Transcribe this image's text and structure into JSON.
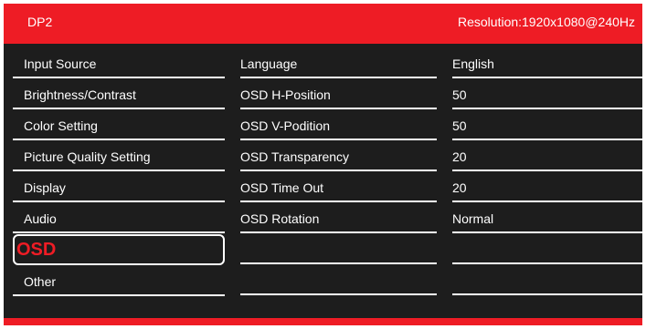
{
  "header": {
    "source": "DP2",
    "resolution": "Resolution:1920x1080@240Hz"
  },
  "menu": [
    {
      "label": "Input Source"
    },
    {
      "label": "Brightness/Contrast"
    },
    {
      "label": "Color Setting"
    },
    {
      "label": "Picture Quality Setting"
    },
    {
      "label": "Display"
    },
    {
      "label": "Audio"
    },
    {
      "label": "OSD",
      "selected": true
    },
    {
      "label": "Other"
    }
  ],
  "settings": [
    {
      "label": "Language",
      "value": "English"
    },
    {
      "label": "OSD H-Position",
      "value": "50"
    },
    {
      "label": "OSD V-Podition",
      "value": "50"
    },
    {
      "label": "OSD Transparency",
      "value": "20"
    },
    {
      "label": "OSD Time Out",
      "value": "20"
    },
    {
      "label": "OSD Rotation",
      "value": "Normal"
    },
    {
      "label": "",
      "value": ""
    },
    {
      "label": "",
      "value": ""
    }
  ],
  "colors": {
    "accent": "#ee1c25",
    "background": "#1d1d1d",
    "text": "#ffffff"
  }
}
